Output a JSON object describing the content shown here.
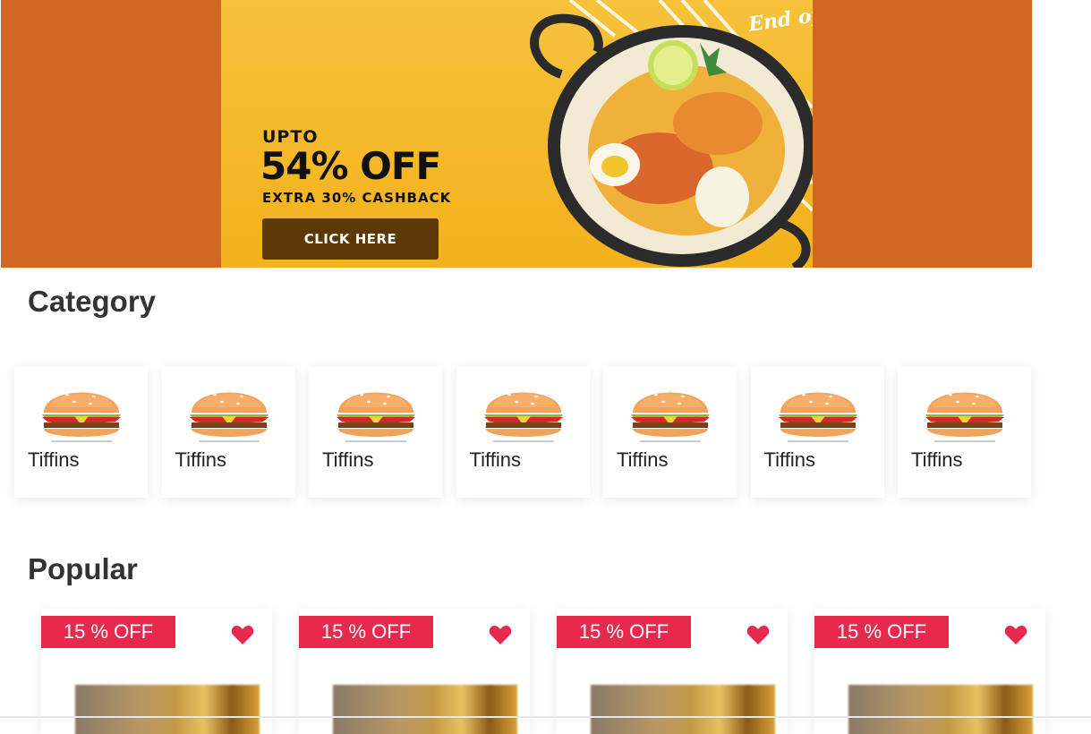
{
  "banner": {
    "upto": "UPTO",
    "discount": "54% OFF",
    "cashback": "EXTRA 30% CASHBACK",
    "cta_label": "CLICK HERE",
    "tagline": "End of t"
  },
  "category": {
    "title": "Category",
    "items": [
      {
        "label": "Tiffins",
        "icon": "burger-icon"
      },
      {
        "label": "Tiffins",
        "icon": "burger-icon"
      },
      {
        "label": "Tiffins",
        "icon": "burger-icon"
      },
      {
        "label": "Tiffins",
        "icon": "burger-icon"
      },
      {
        "label": "Tiffins",
        "icon": "burger-icon"
      },
      {
        "label": "Tiffins",
        "icon": "burger-icon"
      },
      {
        "label": "Tiffins",
        "icon": "burger-icon"
      }
    ]
  },
  "popular": {
    "title": "Popular",
    "items": [
      {
        "badge": "15 % OFF",
        "icon": "heart-icon"
      },
      {
        "badge": "15 % OFF",
        "icon": "heart-icon"
      },
      {
        "badge": "15 % OFF",
        "icon": "heart-icon"
      },
      {
        "badge": "15 % OFF",
        "icon": "heart-icon"
      }
    ]
  },
  "colors": {
    "banner_bg": "#d06723",
    "accent_red": "#e8294e",
    "cta_brown": "#5b3806",
    "banner_yellow": "#f3b11c"
  }
}
